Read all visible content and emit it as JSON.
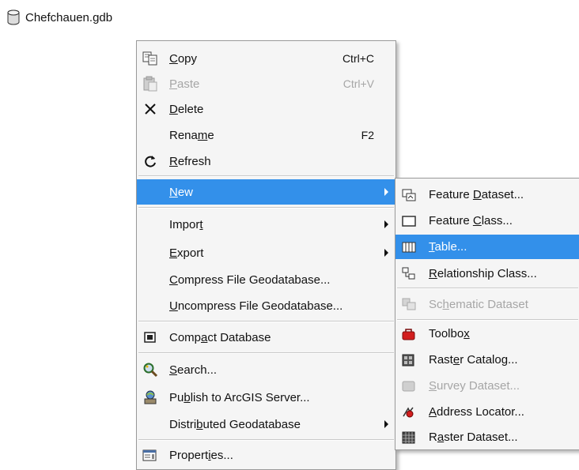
{
  "tree": {
    "node_label": "Chefchauen.gdb",
    "node_icon": "database-icon"
  },
  "context_menu": {
    "copy": {
      "pre": "",
      "key": "C",
      "post": "opy",
      "shortcut": "Ctrl+C",
      "icon": "copy-icon"
    },
    "paste": {
      "pre": "",
      "key": "P",
      "post": "aste",
      "shortcut": "Ctrl+V",
      "icon": "paste-icon",
      "disabled": true
    },
    "delete": {
      "pre": "",
      "key": "D",
      "post": "elete",
      "icon": "close-icon"
    },
    "rename": {
      "pre": "Rena",
      "key": "m",
      "post": "e",
      "shortcut": "F2"
    },
    "refresh": {
      "pre": "",
      "key": "R",
      "post": "efresh",
      "icon": "refresh-icon"
    },
    "new": {
      "pre": "",
      "key": "N",
      "post": "ew",
      "has_submenu": true,
      "highlighted": true
    },
    "import": {
      "pre": "Impor",
      "key": "t",
      "post": "",
      "has_submenu": true
    },
    "export": {
      "pre": "",
      "key": "E",
      "post": "xport",
      "has_submenu": true
    },
    "compress": {
      "pre": "",
      "key": "C",
      "post": "ompress File Geodatabase..."
    },
    "uncompress": {
      "pre": "",
      "key": "U",
      "post": "ncompress File Geodatabase..."
    },
    "compact": {
      "pre": "Comp",
      "key": "a",
      "post": "ct Database",
      "icon": "compact-database-icon"
    },
    "search": {
      "pre": "",
      "key": "S",
      "post": "earch...",
      "icon": "search-icon"
    },
    "publish": {
      "pre": "Pu",
      "key": "b",
      "post": "lish to ArcGIS Server...",
      "icon": "publish-server-icon"
    },
    "distributed": {
      "pre": "Distri",
      "key": "b",
      "post": "uted Geodatabase",
      "has_submenu": true
    },
    "properties": {
      "pre": "Propert",
      "key": "i",
      "post": "es...",
      "icon": "properties-icon"
    }
  },
  "new_submenu": {
    "feature_dataset": {
      "pre": "Feature ",
      "key": "D",
      "post": "ataset...",
      "icon": "feature-dataset-icon"
    },
    "feature_class": {
      "pre": "Feature ",
      "key": "C",
      "post": "lass...",
      "icon": "feature-class-icon"
    },
    "table": {
      "pre": "",
      "key": "T",
      "post": "able...",
      "icon": "table-icon",
      "highlighted": true
    },
    "relationship": {
      "pre": "",
      "key": "R",
      "post": "elationship Class...",
      "icon": "relationship-class-icon"
    },
    "schematic": {
      "pre": "Sc",
      "key": "h",
      "post": "ematic Dataset",
      "icon": "schematic-dataset-icon",
      "disabled": true
    },
    "toolbox": {
      "pre": "Toolbo",
      "key": "x",
      "post": "",
      "icon": "toolbox-icon"
    },
    "raster_catalog": {
      "pre": "Rast",
      "key": "e",
      "post": "r Catalog...",
      "icon": "raster-catalog-icon"
    },
    "survey": {
      "pre": "",
      "key": "S",
      "post": "urvey Dataset...",
      "icon": "survey-dataset-icon",
      "disabled": true
    },
    "address_locator": {
      "pre": "",
      "key": "A",
      "post": "ddress Locator...",
      "icon": "address-locator-icon"
    },
    "raster_dataset": {
      "pre": "R",
      "key": "a",
      "post": "ster Dataset...",
      "icon": "raster-dataset-icon"
    }
  },
  "colors": {
    "highlight": "#3390ea",
    "menu_bg": "#f5f5f5",
    "disabled_text": "#a6a6a6"
  }
}
